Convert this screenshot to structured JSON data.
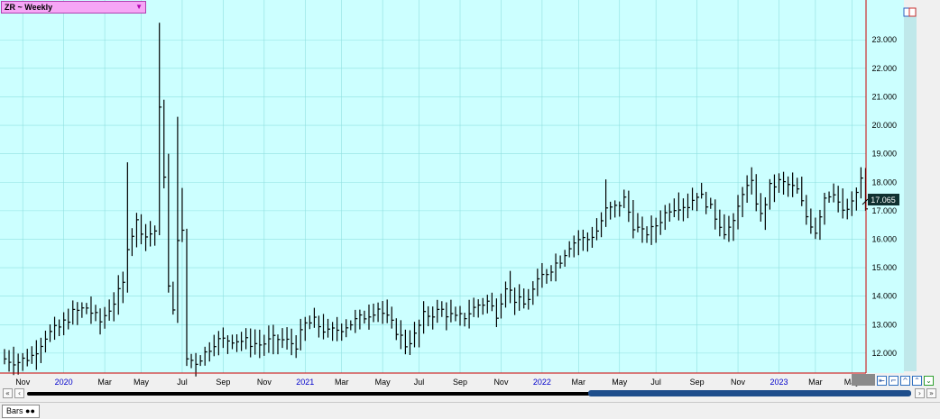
{
  "symbol": {
    "label": "ZR ~ Weekly",
    "dropdown_icon": "triangle-down"
  },
  "last_price": "17.065",
  "status": {
    "tab_label": "Bars"
  },
  "colors": {
    "plot_bg": "#ccffff",
    "grid": "#8fe0e0",
    "bars": "#000000",
    "axis": "#cc0000",
    "last_price_bg": "#103030",
    "year_text": "#0000cc"
  },
  "chart_data": {
    "type": "bar",
    "title": "",
    "xlabel": "",
    "ylabel": "",
    "bar_style": "high-low-close",
    "ylim": [
      11.3,
      24.4
    ],
    "y_ticks": [
      "12.000",
      "13.000",
      "14.000",
      "15.000",
      "16.000",
      "17.000",
      "18.000",
      "19.000",
      "20.000",
      "21.000",
      "22.000",
      "23.000"
    ],
    "x_ticks": [
      {
        "label": "Nov",
        "bar": 4,
        "year": false
      },
      {
        "label": "2020",
        "bar": 13,
        "year": true
      },
      {
        "label": "Mar",
        "bar": 22,
        "year": false
      },
      {
        "label": "May",
        "bar": 30,
        "year": false
      },
      {
        "label": "Jul",
        "bar": 39,
        "year": false
      },
      {
        "label": "Sep",
        "bar": 48,
        "year": false
      },
      {
        "label": "Nov",
        "bar": 57,
        "year": false
      },
      {
        "label": "2021",
        "bar": 66,
        "year": true
      },
      {
        "label": "Mar",
        "bar": 74,
        "year": false
      },
      {
        "label": "May",
        "bar": 83,
        "year": false
      },
      {
        "label": "Jul",
        "bar": 91,
        "year": false
      },
      {
        "label": "Sep",
        "bar": 100,
        "year": false
      },
      {
        "label": "Nov",
        "bar": 109,
        "year": false
      },
      {
        "label": "2022",
        "bar": 118,
        "year": true
      },
      {
        "label": "Mar",
        "bar": 126,
        "year": false
      },
      {
        "label": "May",
        "bar": 135,
        "year": false
      },
      {
        "label": "Jul",
        "bar": 143,
        "year": false
      },
      {
        "label": "Sep",
        "bar": 152,
        "year": false
      },
      {
        "label": "Nov",
        "bar": 161,
        "year": false
      },
      {
        "label": "2023",
        "bar": 170,
        "year": true
      },
      {
        "label": "Mar",
        "bar": 178,
        "year": false
      },
      {
        "label": "May",
        "bar": 186,
        "year": false
      }
    ],
    "anchors": [
      [
        0,
        11.8
      ],
      [
        3,
        11.7
      ],
      [
        6,
        11.9
      ],
      [
        9,
        12.6
      ],
      [
        12,
        12.9
      ],
      [
        15,
        13.4
      ],
      [
        18,
        13.6
      ],
      [
        21,
        13.1
      ],
      [
        24,
        13.8
      ],
      [
        26,
        14.4
      ],
      [
        27,
        15.8
      ],
      [
        29,
        16.6
      ],
      [
        31,
        16.1
      ],
      [
        33,
        16.3
      ],
      [
        34,
        20.5
      ],
      [
        35,
        18.3
      ],
      [
        36,
        14.3
      ],
      [
        37,
        13.4
      ],
      [
        38,
        16.1
      ],
      [
        39,
        16.2
      ],
      [
        40,
        11.8
      ],
      [
        42,
        11.7
      ],
      [
        44,
        12.0
      ],
      [
        46,
        12.4
      ],
      [
        50,
        12.5
      ],
      [
        56,
        12.3
      ],
      [
        60,
        12.5
      ],
      [
        64,
        12.3
      ],
      [
        66,
        13.0
      ],
      [
        68,
        13.1
      ],
      [
        71,
        12.7
      ],
      [
        74,
        12.9
      ],
      [
        78,
        13.2
      ],
      [
        82,
        13.6
      ],
      [
        84,
        13.2
      ],
      [
        86,
        12.8
      ],
      [
        88,
        12.3
      ],
      [
        90,
        12.6
      ],
      [
        92,
        13.3
      ],
      [
        94,
        13.4
      ],
      [
        96,
        13.5
      ],
      [
        99,
        13.2
      ],
      [
        101,
        13.3
      ],
      [
        104,
        13.7
      ],
      [
        106,
        13.8
      ],
      [
        108,
        13.4
      ],
      [
        110,
        14.4
      ],
      [
        112,
        13.9
      ],
      [
        114,
        13.7
      ],
      [
        116,
        14.2
      ],
      [
        118,
        14.7
      ],
      [
        120,
        15.0
      ],
      [
        122,
        15.3
      ],
      [
        124,
        15.8
      ],
      [
        126,
        16.0
      ],
      [
        128,
        16.0
      ],
      [
        130,
        16.3
      ],
      [
        132,
        17.0
      ],
      [
        134,
        17.1
      ],
      [
        136,
        17.4
      ],
      [
        138,
        16.5
      ],
      [
        140,
        16.2
      ],
      [
        142,
        16.3
      ],
      [
        144,
        16.7
      ],
      [
        146,
        17.1
      ],
      [
        148,
        17.2
      ],
      [
        150,
        17.2
      ],
      [
        152,
        17.6
      ],
      [
        154,
        17.3
      ],
      [
        156,
        16.8
      ],
      [
        158,
        16.3
      ],
      [
        160,
        16.5
      ],
      [
        162,
        17.7
      ],
      [
        164,
        17.9
      ],
      [
        166,
        16.8
      ],
      [
        168,
        17.8
      ],
      [
        170,
        18.0
      ],
      [
        172,
        17.9
      ],
      [
        174,
        17.7
      ],
      [
        176,
        16.8
      ],
      [
        178,
        16.3
      ],
      [
        180,
        17.5
      ],
      [
        182,
        17.7
      ],
      [
        184,
        16.9
      ],
      [
        186,
        17.2
      ],
      [
        188,
        18.1
      ],
      [
        189,
        17.065
      ]
    ],
    "spikes": {
      "27": 18.7,
      "34": 23.6,
      "36": 19.0,
      "38": 20.3,
      "39": 17.8,
      "132": 18.1
    }
  }
}
